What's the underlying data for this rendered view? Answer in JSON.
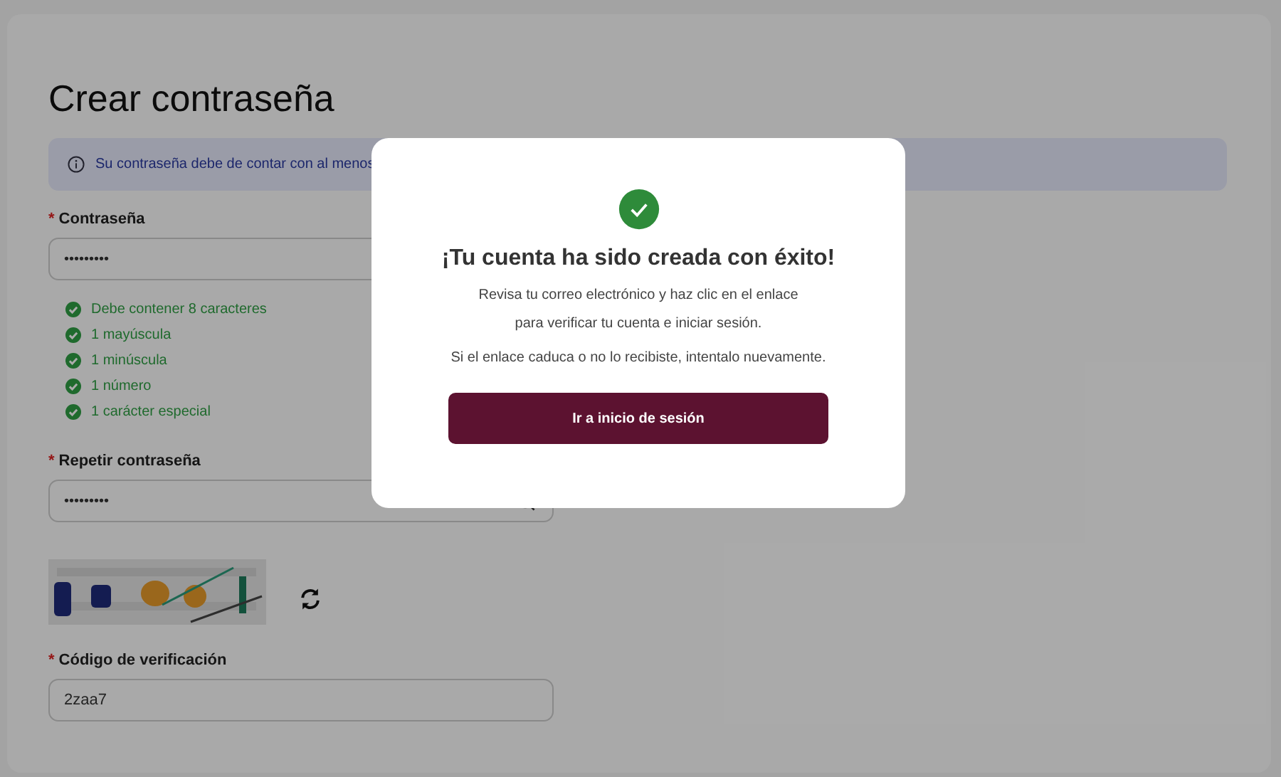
{
  "page": {
    "title": "Crear contraseña",
    "info": "Su contraseña debe de contar con al menos",
    "password": {
      "label": "Contraseña",
      "required_mark": "*",
      "value": "•••••••••"
    },
    "requirements": [
      {
        "text": "Debe contener 8 caracteres",
        "met": true
      },
      {
        "text": "1 mayúscula",
        "met": true
      },
      {
        "text": "1 minúscula",
        "met": true
      },
      {
        "text": "1 número",
        "met": true
      },
      {
        "text": "1 carácter especial",
        "met": true
      }
    ],
    "repeat_password": {
      "label": "Repetir contraseña",
      "required_mark": "*",
      "value": "•••••••••"
    },
    "verification_code": {
      "label": "Código de verificación",
      "required_mark": "*",
      "value": "2zaa7"
    }
  },
  "modal": {
    "title": "¡Tu cuenta ha sido creada con éxito!",
    "lines": [
      "Revisa tu correo electrónico y haz clic en el enlace",
      "para verificar tu cuenta e iniciar sesión."
    ],
    "note": "Si el enlace caduca o no lo recibiste, intentalo nuevamente.",
    "button": "Ir a inicio de sesión"
  }
}
